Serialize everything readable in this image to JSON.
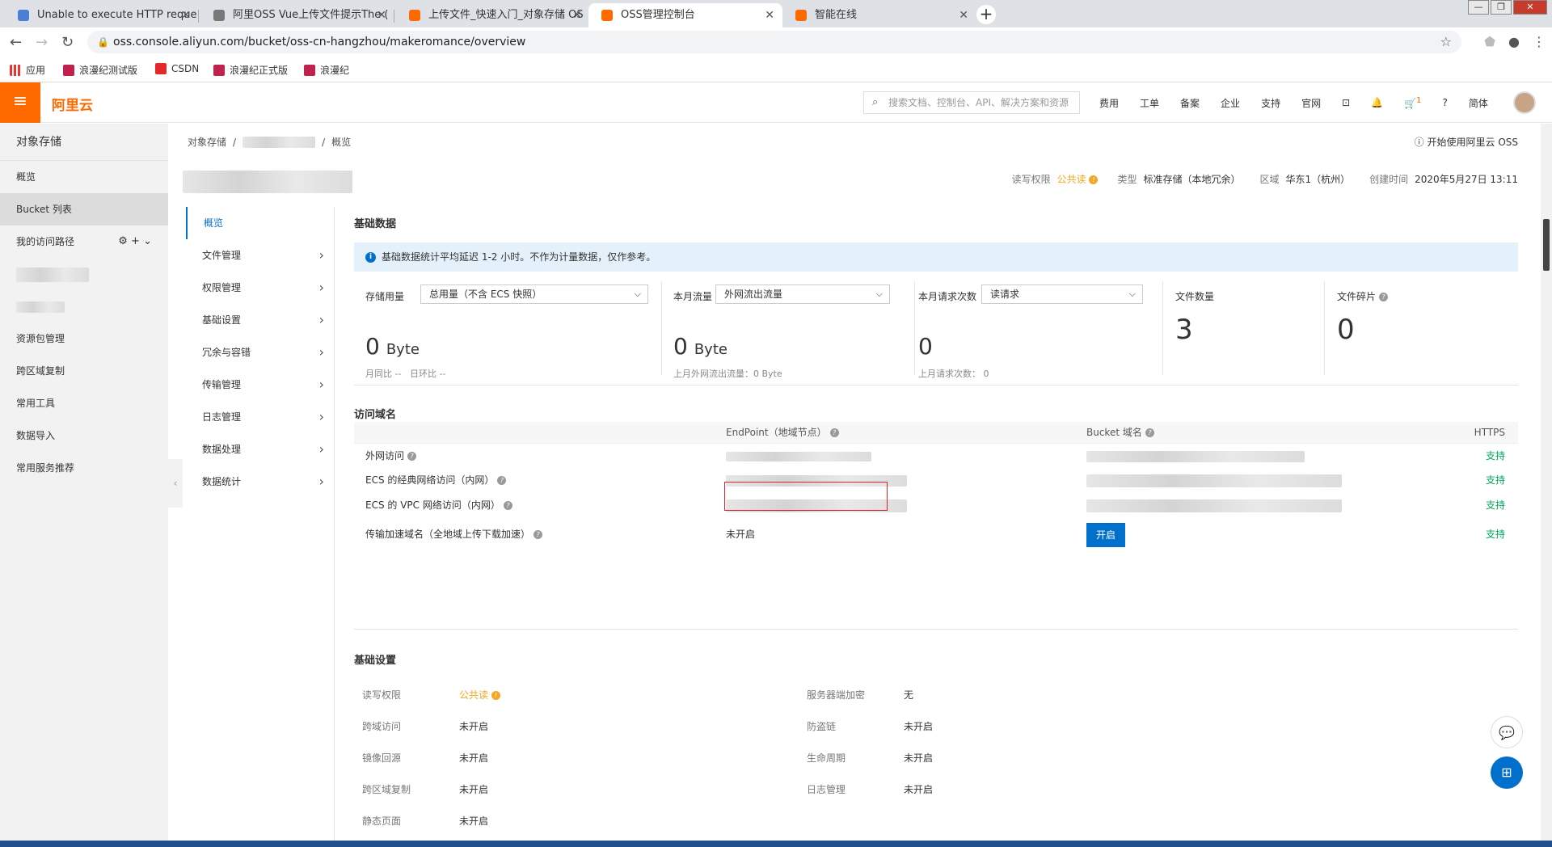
{
  "browser": {
    "tabs": [
      {
        "title": "Unable to execute HTTP reque",
        "active": false
      },
      {
        "title": "阿里OSS Vue上传文件提示The (",
        "active": false
      },
      {
        "title": "上传文件_快速入门_对象存储 OS",
        "active": false
      },
      {
        "title": "OSS管理控制台",
        "active": true
      },
      {
        "title": "智能在线",
        "active": false
      }
    ],
    "url": "oss.console.aliyun.com/bucket/oss-cn-hangzhou/makeromance/overview",
    "bookmarks": [
      "应用",
      "浪漫纪测试版",
      "CSDN",
      "浪漫纪正式版",
      "浪漫纪"
    ]
  },
  "topbar": {
    "logo": "阿里云",
    "search_placeholder": "搜索文档、控制台、API、解决方案和资源",
    "nav": [
      "费用",
      "工单",
      "备案",
      "企业",
      "支持",
      "官网"
    ],
    "cart_badge": "1",
    "lang": "简体"
  },
  "sidebar": {
    "title": "对象存储",
    "items": [
      "概览",
      "Bucket 列表",
      "我的访问路径",
      "资源包管理",
      "跨区域复制",
      "常用工具",
      "数据导入",
      "常用服务推荐"
    ]
  },
  "breadcrumb": {
    "root": "对象存储",
    "current": "概览"
  },
  "help_link": "开始使用阿里云 OSS",
  "meta": {
    "acl_label": "读写权限",
    "acl_value": "公共读",
    "type_label": "类型",
    "type_value": "标准存储（本地冗余）",
    "region_label": "区域",
    "region_value": "华东1（杭州）",
    "created_label": "创建时间",
    "created_value": "2020年5月27日 13:11"
  },
  "subnav": [
    "概览",
    "文件管理",
    "权限管理",
    "基础设置",
    "冗余与容错",
    "传输管理",
    "日志管理",
    "数据处理",
    "数据统计"
  ],
  "basic_data": {
    "title": "基础数据",
    "notice": "基础数据统计平均延迟 1-2 小时。不作为计量数据，仅作参考。",
    "storage": {
      "label": "存储用量",
      "select": "总用量（不含 ECS 快照）",
      "value": "0",
      "unit": "Byte",
      "sub1": "月同比",
      "sub1v": "--",
      "sub2": "日环比",
      "sub2v": "--"
    },
    "traffic": {
      "label": "本月流量",
      "select": "外网流出流量",
      "value": "0",
      "unit": "Byte",
      "sub": "上月外网流出流量：0 Byte"
    },
    "requests": {
      "label": "本月请求次数",
      "select": "读请求",
      "value": "0",
      "sub": "上月请求次数：  0"
    },
    "files": {
      "label": "文件数量",
      "value": "3"
    },
    "fragments": {
      "label": "文件碎片",
      "value": "0"
    }
  },
  "access": {
    "title": "访问域名",
    "headers": {
      "endpoint": "EndPoint（地域节点）",
      "bucket": "Bucket 域名",
      "https": "HTTPS"
    },
    "rows": [
      {
        "name": "外网访问",
        "endpoint": "",
        "https": "支持"
      },
      {
        "name": "ECS 的经典网络访问（内网）",
        "endpoint": "",
        "https": "支持"
      },
      {
        "name": "ECS 的 VPC 网络访问（内网）",
        "endpoint": "",
        "https": "支持"
      },
      {
        "name": "传输加速域名（全地域上传下载加速）",
        "endpoint": "未开启",
        "button": "开启",
        "https": "支持"
      }
    ]
  },
  "settings": {
    "title": "基础设置",
    "left": [
      {
        "k": "读写权限",
        "v": "公共读"
      },
      {
        "k": "跨域访问",
        "v": "未开启"
      },
      {
        "k": "镜像回源",
        "v": "未开启"
      },
      {
        "k": "跨区域复制",
        "v": "未开启"
      },
      {
        "k": "静态页面",
        "v": "未开启"
      }
    ],
    "right": [
      {
        "k": "服务器端加密",
        "v": "无"
      },
      {
        "k": "防盗链",
        "v": "未开启"
      },
      {
        "k": "生命周期",
        "v": "未开启"
      },
      {
        "k": "日志管理",
        "v": "未开启"
      }
    ]
  }
}
